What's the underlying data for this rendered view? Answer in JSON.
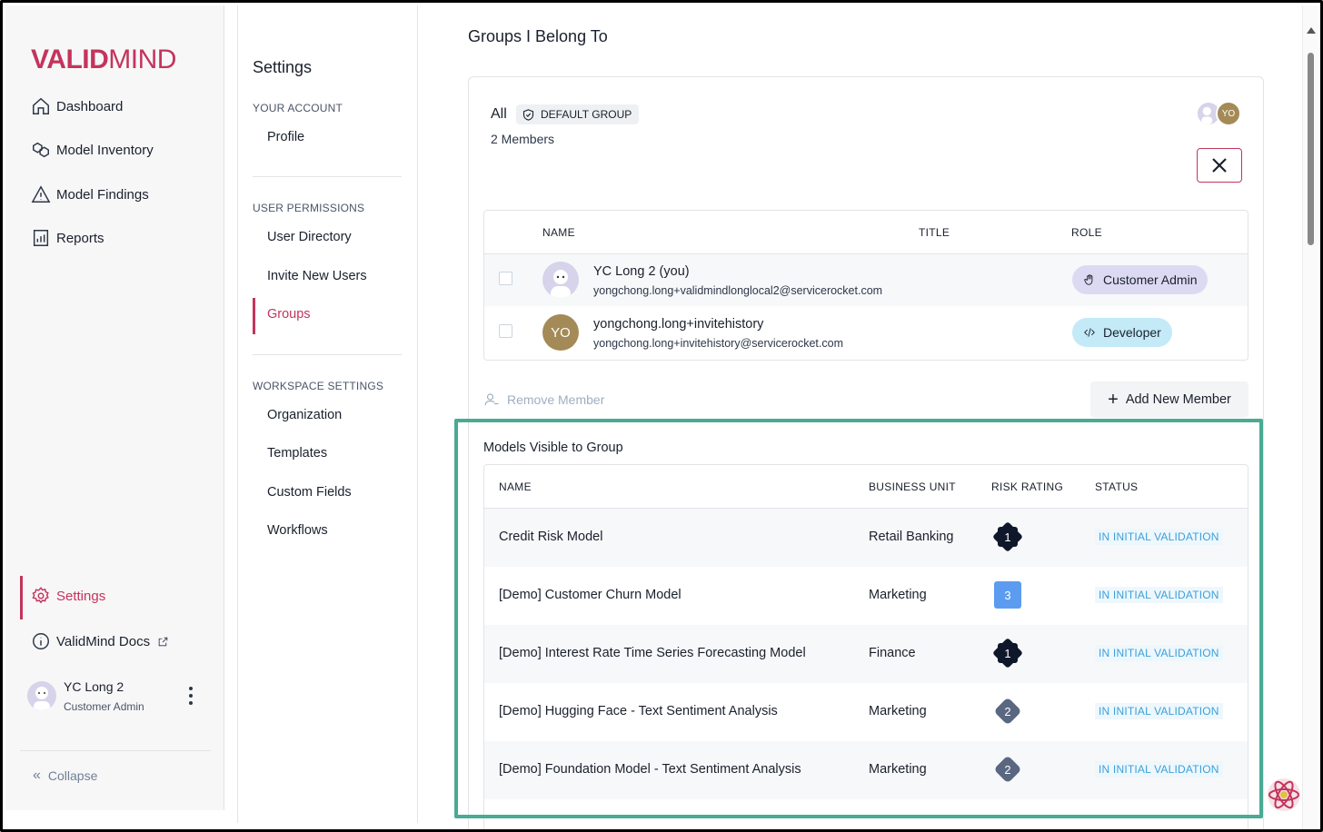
{
  "brand": {
    "logo_bold": "VALID",
    "logo_light": "MIND",
    "accent": "#c4345c"
  },
  "sidebar": {
    "nav": [
      {
        "label": "Dashboard",
        "icon": "home-icon"
      },
      {
        "label": "Model Inventory",
        "icon": "cubes-icon"
      },
      {
        "label": "Model Findings",
        "icon": "warning-icon"
      },
      {
        "label": "Reports",
        "icon": "chart-icon"
      }
    ],
    "settings_label": "Settings",
    "docs_label": "ValidMind Docs",
    "user_name": "YC Long 2",
    "user_role": "Customer Admin",
    "collapse_label": "Collapse"
  },
  "settings_nav": {
    "title": "Settings",
    "sections": [
      {
        "label": "YOUR ACCOUNT",
        "items": [
          "Profile"
        ]
      },
      {
        "label": "USER PERMISSIONS",
        "items": [
          "User Directory",
          "Invite New Users",
          "Groups"
        ]
      },
      {
        "label": "WORKSPACE SETTINGS",
        "items": [
          "Organization",
          "Templates",
          "Custom Fields",
          "Workflows"
        ]
      }
    ],
    "active_item": "Groups"
  },
  "main": {
    "page_title": "Groups I Belong To",
    "group": {
      "name": "All",
      "badge": "DEFAULT GROUP",
      "member_count": "2 Members",
      "avatar_initials": "YO"
    },
    "members_table": {
      "headers": {
        "name": "NAME",
        "title": "TITLE",
        "role": "ROLE"
      },
      "rows": [
        {
          "name": "YC Long 2 (you)",
          "email": "yongchong.long+validmindlonglocal2@servicerocket.com",
          "title": "",
          "role": "Customer Admin",
          "avatar": ""
        },
        {
          "name": "yongchong.long+invitehistory",
          "email": "yongchong.long+invitehistory@servicerocket.com",
          "title": "",
          "role": "Developer",
          "avatar": "YO"
        }
      ]
    },
    "remove_member_label": "Remove Member",
    "add_member_label": "Add New Member",
    "models_title": "Models Visible to Group",
    "models_table": {
      "headers": {
        "name": "NAME",
        "business_unit": "BUSINESS UNIT",
        "risk_rating": "RISK RATING",
        "status": "STATUS"
      },
      "rows": [
        {
          "name": "Credit Risk Model",
          "business_unit": "Retail Banking",
          "risk": "1",
          "status": "IN INITIAL VALIDATION"
        },
        {
          "name": "[Demo] Customer Churn Model",
          "business_unit": "Marketing",
          "risk": "3",
          "status": "IN INITIAL VALIDATION"
        },
        {
          "name": "[Demo] Interest Rate Time Series Forecasting Model",
          "business_unit": "Finance",
          "risk": "1",
          "status": "IN INITIAL VALIDATION"
        },
        {
          "name": "[Demo] Hugging Face - Text Sentiment Analysis",
          "business_unit": "Marketing",
          "risk": "2",
          "status": "IN INITIAL VALIDATION"
        },
        {
          "name": "[Demo] Foundation Model - Text Sentiment Analysis",
          "business_unit": "Marketing",
          "risk": "2",
          "status": "IN INITIAL VALIDATION"
        }
      ]
    }
  },
  "colors": {
    "highlight": "#4aaa94",
    "status_text": "#3ba0d9",
    "risk_1": "#0f172a",
    "risk_2": "#5a6781",
    "risk_3": "#5b9cf1"
  }
}
